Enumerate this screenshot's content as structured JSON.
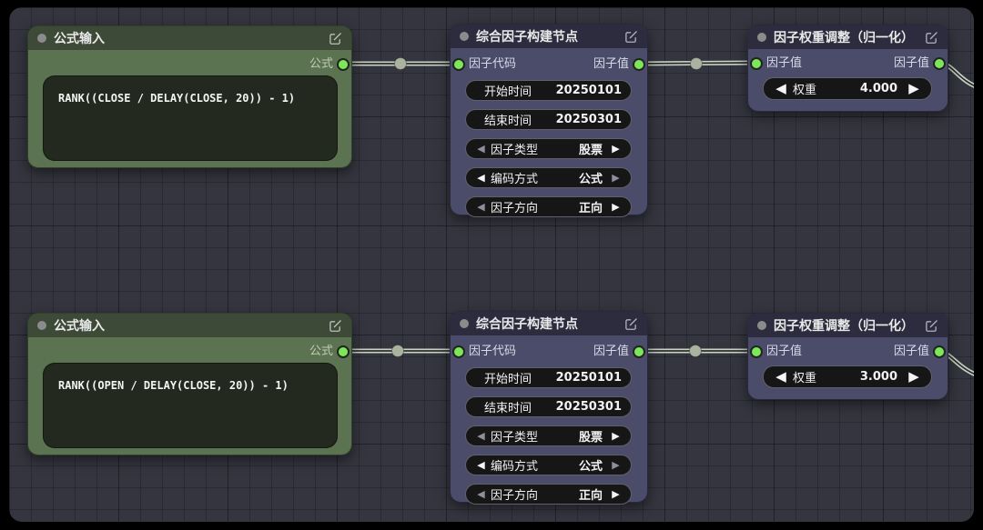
{
  "icons": {
    "arrow_left": "◀",
    "arrow_right": "▶"
  },
  "colors": {
    "frame": "#000000",
    "canvas_background": "#35353f",
    "wire": "#c9d3c0",
    "port": "#7de65a",
    "reroute_dot": "#a9b3a0",
    "formula_node_header": "#3d4a37",
    "formula_node_body": "#5b7350",
    "formula_box_background": "#24291f",
    "builder_node_header": "#2c2c3e",
    "builder_node_body": "#4b4b6a",
    "widget_background": "#161616"
  },
  "nodes": [
    {
      "title": "公式输入",
      "output_label": "公式",
      "formula": "RANK((CLOSE / DELAY(CLOSE, 20)) - 1)"
    },
    {
      "title": "综合因子构建节点",
      "input_label": "因子代码",
      "output_label": "因子值",
      "widgets": [
        {
          "label": "开始时间",
          "value": "20250101"
        },
        {
          "label": "结束时间",
          "value": "20250301"
        },
        {
          "label": "因子类型",
          "value": "股票"
        },
        {
          "label": "编码方式",
          "value": "公式"
        },
        {
          "label": "因子方向",
          "value": "正向"
        }
      ]
    },
    {
      "title": "因子权重调整（归一化）",
      "input_label": "因子值",
      "output_label": "因子值",
      "widgets": [
        {
          "label": "权重",
          "value": "4.000"
        }
      ]
    },
    {
      "title": "公式输入",
      "output_label": "公式",
      "formula": "RANK((OPEN / DELAY(CLOSE, 20)) - 1)"
    },
    {
      "title": "综合因子构建节点",
      "input_label": "因子代码",
      "output_label": "因子值",
      "widgets": [
        {
          "label": "开始时间",
          "value": "20250101"
        },
        {
          "label": "结束时间",
          "value": "20250301"
        },
        {
          "label": "因子类型",
          "value": "股票"
        },
        {
          "label": "编码方式",
          "value": "公式"
        },
        {
          "label": "因子方向",
          "value": "正向"
        }
      ]
    },
    {
      "title": "因子权重调整（归一化）",
      "input_label": "因子值",
      "output_label": "因子值",
      "widgets": [
        {
          "label": "权重",
          "value": "3.000"
        }
      ]
    }
  ]
}
